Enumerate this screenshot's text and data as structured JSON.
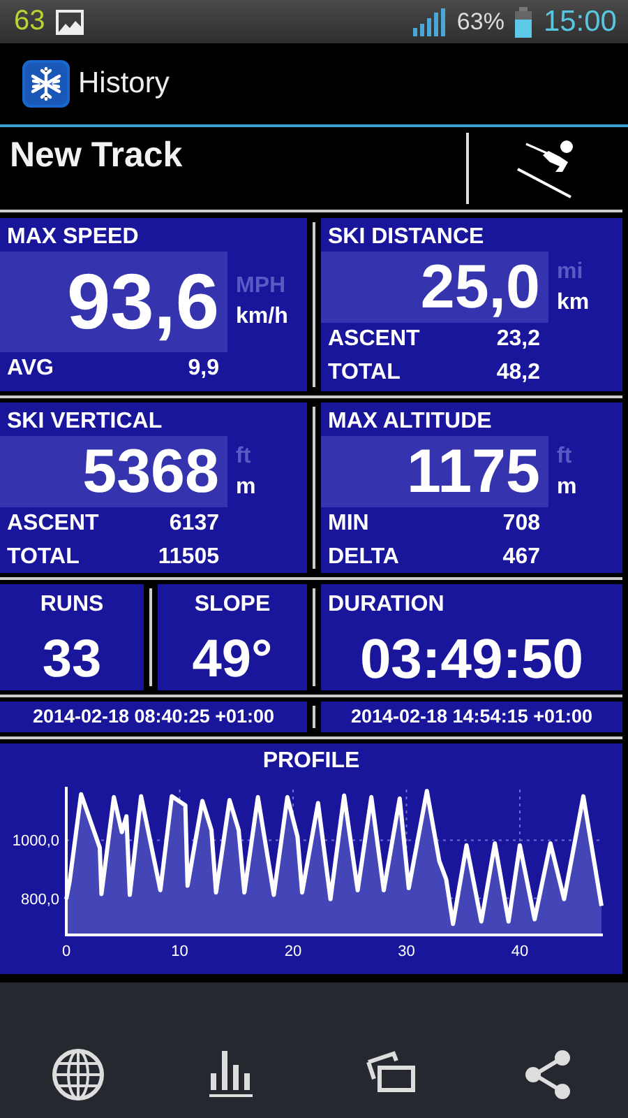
{
  "status_bar": {
    "notification_count": "63",
    "battery": "63%",
    "time": "15:00"
  },
  "app_bar": {
    "title": "History"
  },
  "track": {
    "name": "New Track"
  },
  "panels": [
    {
      "title": "MAX SPEED",
      "value": "93,6",
      "units": [
        {
          "label": "MPH",
          "selected": false
        },
        {
          "label": "km/h",
          "selected": true
        }
      ],
      "rows": [
        {
          "label": "AVG",
          "value": "9,9"
        }
      ]
    },
    {
      "title": "SKI DISTANCE",
      "value": "25,0",
      "units": [
        {
          "label": "mi",
          "selected": false
        },
        {
          "label": "km",
          "selected": true
        }
      ],
      "rows": [
        {
          "label": "ASCENT",
          "value": "23,2"
        },
        {
          "label": "TOTAL",
          "value": "48,2"
        }
      ]
    },
    {
      "title": "SKI VERTICAL",
      "value": "5368",
      "units": [
        {
          "label": "ft",
          "selected": false
        },
        {
          "label": "m",
          "selected": true
        }
      ],
      "rows": [
        {
          "label": "ASCENT",
          "value": "6137"
        },
        {
          "label": "TOTAL",
          "value": "11505"
        }
      ]
    },
    {
      "title": "MAX ALTITUDE",
      "value": "1175",
      "units": [
        {
          "label": "ft",
          "selected": false
        },
        {
          "label": "m",
          "selected": true
        }
      ],
      "rows": [
        {
          "label": "MIN",
          "value": "708"
        },
        {
          "label": "DELTA",
          "value": "467"
        }
      ]
    }
  ],
  "counters": [
    {
      "title": "RUNS",
      "value": "33"
    },
    {
      "title": "SLOPE",
      "value": "49°"
    },
    {
      "title": "DURATION",
      "value": "03:49:50"
    }
  ],
  "times": [
    "2014-02-18 08:40:25 +01:00",
    "2014-02-18 14:54:15 +01:00"
  ],
  "profile": {
    "chart_data": {
      "type": "area",
      "title": "PROFILE",
      "x": [
        0,
        0.3,
        1.3,
        2.95,
        3.1,
        4.2,
        4.9,
        5.3,
        5.6,
        6.6,
        8.3,
        9.3,
        10.5,
        10.7,
        12.0,
        12.8,
        13.2,
        14.4,
        15.2,
        15.7,
        16.9,
        18.3,
        19.5,
        20.4,
        20.8,
        22.2,
        23.3,
        24.5,
        25.7,
        26.9,
        28.0,
        29.4,
        30.2,
        31.8,
        32.9,
        33.5,
        34.1,
        35.3,
        36.6,
        37.8,
        39.0,
        40.0,
        41.3,
        42.7,
        43.9,
        45.6,
        47.2
      ],
      "series": [
        {
          "color": "#ffffff",
          "values": [
            797,
            858,
            1158,
            974,
            815,
            1148,
            1028,
            1082,
            812,
            1151,
            828,
            1151,
            1120,
            843,
            1135,
            1035,
            820,
            1138,
            1035,
            820,
            1148,
            812,
            1148,
            1012,
            820,
            1128,
            797,
            1154,
            828,
            1148,
            828,
            1143,
            835,
            1169,
            928,
            866,
            712,
            982,
            720,
            989,
            720,
            982,
            728,
            989,
            797,
            1151,
            774
          ]
        }
      ],
      "xlim": [
        0,
        47.2
      ],
      "ylim": [
        674,
        1174
      ],
      "grid": true,
      "xticks": [
        0,
        10,
        20,
        30,
        40
      ],
      "yticks": [
        {
          "value": 800,
          "label": "800,0"
        },
        {
          "value": 1000,
          "label": "1000,0"
        }
      ]
    }
  }
}
